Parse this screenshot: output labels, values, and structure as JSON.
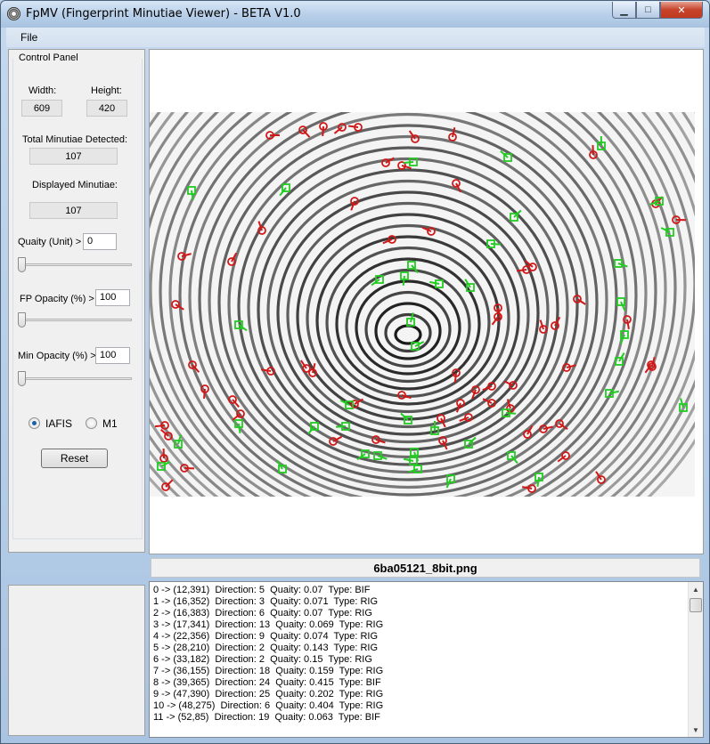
{
  "window": {
    "title": "FpMV (Fingerprint Minutiae Viewer) - BETA V1.0"
  },
  "menu": {
    "file": "File"
  },
  "control_panel": {
    "title": "Control Panel",
    "width_label": "Width:",
    "width_value": "609",
    "height_label": "Height:",
    "height_value": "420",
    "total_label": "Total Minutiae Detected:",
    "total_value": "107",
    "displayed_label": "Displayed Minutiae:",
    "displayed_value": "107",
    "quality_label": "Quaity (Unit) >",
    "quality_value": "0",
    "fp_opacity_label": "FP Opacity (%)  >",
    "fp_opacity_value": "100",
    "min_opacity_label": "Min Opacity (%) >",
    "min_opacity_value": "100",
    "radio_iafis": "IAFIS",
    "radio_m1": "M1",
    "reset_label": "Reset",
    "quality_slider_level": 0,
    "fp_opacity_slider_level": 0,
    "min_opacity_slider_level": 0
  },
  "image": {
    "filename": "6ba05121_8bit.png"
  },
  "minutiae_list": [
    "0 -> (12,391)  Direction: 5  Quaity: 0.07  Type: BIF",
    "1 -> (16,352)  Direction: 3  Quaity: 0.071  Type: RIG",
    "2 -> (16,383)  Direction: 6  Quaity: 0.07  Type: RIG",
    "3 -> (17,341)  Direction: 13  Quaity: 0.069  Type: RIG",
    "4 -> (22,356)  Direction: 9  Quaity: 0.074  Type: RIG",
    "5 -> (28,210)  Direction: 2  Quaity: 0.143  Type: RIG",
    "6 -> (33,182)  Direction: 2  Quaity: 0.15  Type: RIG",
    "7 -> (36,155)  Direction: 18  Quaity: 0.159  Type: RIG",
    "8 -> (39,365)  Direction: 24  Quaity: 0.415  Type: BIF",
    "9 -> (47,390)  Direction: 25  Quaity: 0.202  Type: RIG",
    "10 -> (48,275)  Direction: 6  Quaity: 0.404  Type: RIG",
    "11 -> (52,85)  Direction: 19  Quaity: 0.063  Type: BIF"
  ],
  "colors": {
    "ridge_ending": "#d01818",
    "bifurcation": "#22cc22",
    "accent": "#1f5fa8"
  },
  "icons": {
    "app": "fingerprint-icon",
    "minimize": "minimize-icon",
    "maximize": "maximize-icon",
    "close": "close-icon",
    "scroll_up": "scroll-up-icon",
    "scroll_down": "scroll-down-icon"
  }
}
